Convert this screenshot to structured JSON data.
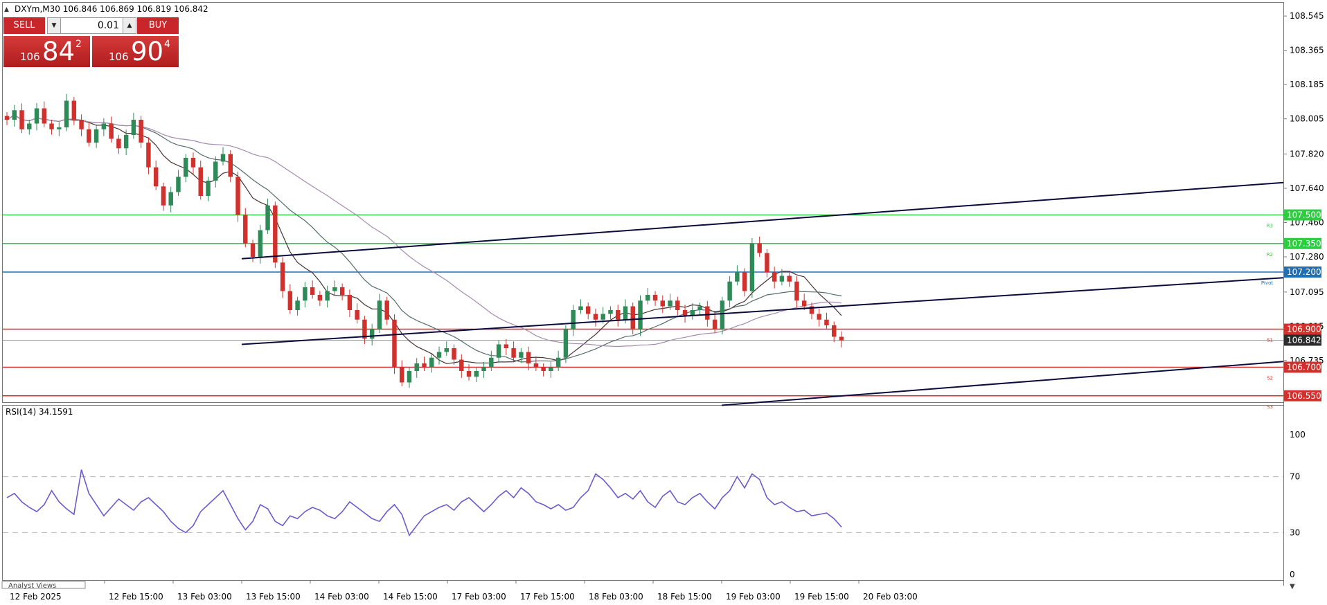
{
  "header": {
    "text": "DXYm,M30  106.846 106.869 106.819 106.842"
  },
  "trade_panel": {
    "sell_label": "SELL",
    "buy_label": "BUY",
    "volume": "0.01",
    "sell_price": {
      "small": "106",
      "big": "84",
      "sup": "2"
    },
    "buy_price": {
      "small": "106",
      "big": "90",
      "sup": "4"
    }
  },
  "price_axis": {
    "ticks": [
      "108.545",
      "108.365",
      "108.185",
      "108.005",
      "107.820",
      "107.640",
      "107.460",
      "107.280",
      "107.095",
      "106.915",
      "106.735"
    ]
  },
  "levels": [
    {
      "label": "107.500",
      "price": 107.5,
      "color": "#2ecc40",
      "tag": "R3"
    },
    {
      "label": "107.350",
      "price": 107.35,
      "color": "#2ecc40",
      "tag": "R2"
    },
    {
      "label": "107.200",
      "price": 107.2,
      "color": "#1f6fb5",
      "tag": "Pivot"
    },
    {
      "label": "106.900",
      "price": 106.9,
      "color": "#d0312d",
      "tag": "S1"
    },
    {
      "label": "106.700",
      "price": 106.7,
      "color": "#d0312d",
      "tag": "S2"
    },
    {
      "label": "106.550",
      "price": 106.55,
      "color": "#d0312d",
      "tag": "S3"
    }
  ],
  "current_price": {
    "label": "106.842",
    "price": 106.842,
    "color": "#2b2b2b"
  },
  "rsi": {
    "title": "RSI(14) 34.1591",
    "levels": [
      "100",
      "70",
      "30",
      "0"
    ],
    "color": "#6a5acd"
  },
  "time_axis": {
    "labels": [
      "12 Feb 2025",
      "12 Feb 15:00",
      "13 Feb 03:00",
      "13 Feb 15:00",
      "14 Feb 03:00",
      "14 Feb 15:00",
      "17 Feb 03:00",
      "17 Feb 15:00",
      "18 Feb 03:00",
      "18 Feb 15:00",
      "19 Feb 03:00",
      "19 Feb 15:00",
      "20 Feb 03:00"
    ]
  },
  "footer": {
    "tab_label": "Analyst Views"
  },
  "colors": {
    "bull": "#2e8b57",
    "bear": "#d0312d",
    "trendline": "#0a0a3c",
    "ma_fast": "#4a3030",
    "ma_mid": "#556b6b",
    "ma_slow": "#a58ab0"
  },
  "chart_data": {
    "type": "candlestick",
    "symbol": "DXYm",
    "timeframe": "M30",
    "ylim": [
      106.52,
      108.6
    ],
    "close_path": [
      108.0,
      108.05,
      107.95,
      107.98,
      108.06,
      107.98,
      107.95,
      107.96,
      108.1,
      108.0,
      107.95,
      107.88,
      107.95,
      107.98,
      107.9,
      107.85,
      107.92,
      108.0,
      107.88,
      107.75,
      107.65,
      107.55,
      107.62,
      107.7,
      107.8,
      107.75,
      107.6,
      107.68,
      107.78,
      107.82,
      107.7,
      107.5,
      107.35,
      107.28,
      107.42,
      107.55,
      107.25,
      107.1,
      107.0,
      107.05,
      107.12,
      107.08,
      107.05,
      107.1,
      107.12,
      107.08,
      107.0,
      106.95,
      106.85,
      106.9,
      107.05,
      106.95,
      106.7,
      106.62,
      106.68,
      106.72,
      106.7,
      106.75,
      106.78,
      106.8,
      106.74,
      106.68,
      106.65,
      106.68,
      106.7,
      106.75,
      106.82,
      106.8,
      106.75,
      106.78,
      106.72,
      106.7,
      106.68,
      106.7,
      106.75,
      106.9,
      107.0,
      107.02,
      106.98,
      106.95,
      106.98,
      107.0,
      106.95,
      107.02,
      106.9,
      107.05,
      107.08,
      107.05,
      107.02,
      107.05,
      107.0,
      106.97,
      107.0,
      107.02,
      106.95,
      106.9,
      107.05,
      107.15,
      107.2,
      107.1,
      107.35,
      107.3,
      107.2,
      107.15,
      107.18,
      107.15,
      107.05,
      107.02,
      106.98,
      106.95,
      106.92,
      106.86,
      106.84
    ],
    "rsi_values": [
      55,
      58,
      52,
      48,
      45,
      50,
      60,
      52,
      47,
      43,
      75,
      58,
      50,
      42,
      48,
      54,
      50,
      46,
      52,
      55,
      50,
      45,
      38,
      33,
      30,
      35,
      45,
      50,
      55,
      60,
      50,
      40,
      32,
      38,
      50,
      47,
      38,
      35,
      42,
      40,
      45,
      48,
      46,
      42,
      40,
      45,
      52,
      48,
      44,
      40,
      38,
      45,
      50,
      43,
      28,
      35,
      42,
      45,
      48,
      50,
      46,
      52,
      55,
      50,
      45,
      50,
      56,
      60,
      55,
      62,
      58,
      52,
      50,
      47,
      50,
      46,
      48,
      55,
      60,
      72,
      68,
      62,
      55,
      58,
      54,
      60,
      52,
      48,
      56,
      60,
      52,
      50,
      55,
      58,
      52,
      47,
      55,
      60,
      70,
      62,
      72,
      68,
      55,
      50,
      52,
      48,
      45,
      46,
      42,
      43,
      44,
      40,
      34
    ],
    "trendlines": [
      {
        "name": "upper channel",
        "from": [
          "13 Feb 15:00",
          107.27
        ],
        "to": [
          "end",
          107.67
        ]
      },
      {
        "name": "middle channel",
        "from": [
          "13 Feb 15:00",
          106.82
        ],
        "to": [
          "end",
          107.17
        ]
      },
      {
        "name": "lower channel",
        "from": [
          "19 Feb 03:00",
          106.5
        ],
        "to": [
          "end",
          106.73
        ]
      }
    ]
  }
}
